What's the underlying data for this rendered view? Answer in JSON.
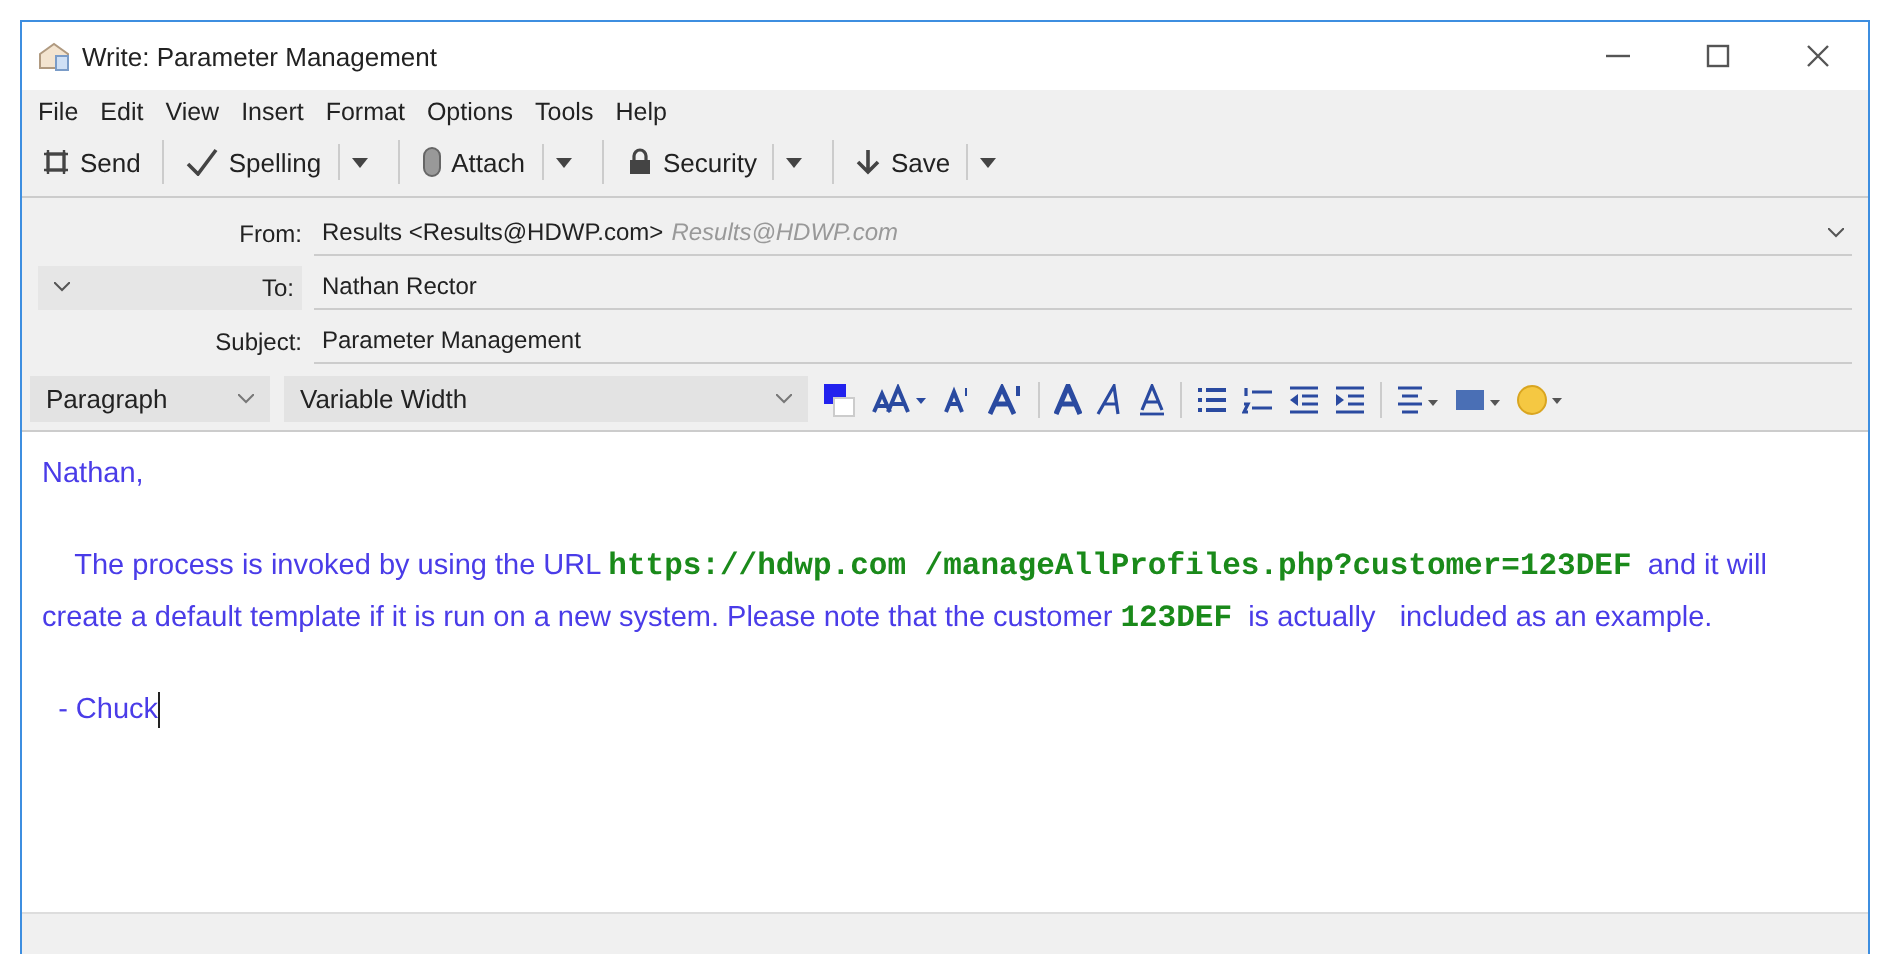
{
  "window": {
    "title": "Write: Parameter Management"
  },
  "menu": [
    "File",
    "Edit",
    "View",
    "Insert",
    "Format",
    "Options",
    "Tools",
    "Help"
  ],
  "toolbar": [
    {
      "kind": "send",
      "label": "Send",
      "dropdown": false
    },
    {
      "kind": "spelling",
      "label": "Spelling",
      "dropdown": true
    },
    {
      "kind": "attach",
      "label": "Attach",
      "dropdown": true
    },
    {
      "kind": "security",
      "label": "Security",
      "dropdown": true
    },
    {
      "kind": "save",
      "label": "Save",
      "dropdown": true
    }
  ],
  "header": {
    "from_label": "From:",
    "from_value": "Results <Results@HDWP.com>",
    "from_hint": "Results@HDWP.com",
    "to_label": "To:",
    "to_value": "Nathan Rector",
    "subject_label": "Subject:",
    "subject_value": "Parameter Management"
  },
  "format": {
    "paragraph": "Paragraph",
    "font": "Variable Width"
  },
  "body": [
    [
      {
        "kind": "text",
        "text": "Nathan,"
      }
    ],
    [
      {
        "kind": "text",
        "text": "    The process is invoked by using the URL "
      },
      {
        "kind": "code",
        "text": "https://hdwp.com /manageAllProfiles.php?customer=123DEF"
      },
      {
        "kind": "text",
        "text": "  and it will create a default template if it is run on a new system. Please note that the customer "
      },
      {
        "kind": "code",
        "text": "123DEF"
      },
      {
        "kind": "text",
        "text": "  is actually   included as an example."
      }
    ],
    [
      {
        "kind": "text",
        "text": "  - Chuck"
      }
    ]
  ]
}
